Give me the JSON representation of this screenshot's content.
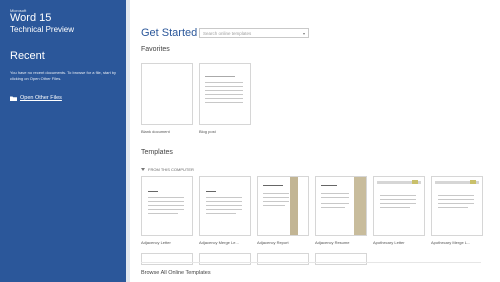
{
  "sidebar": {
    "brand_small": "Microsoft",
    "title": "Word 15",
    "subtitle": "Technical Preview",
    "recent_heading": "Recent",
    "recent_message": "You have no recent documents. To browse for a file, start by clicking on Open Other Files.",
    "open_other_label": "Open Other Files"
  },
  "main": {
    "heading": "Get Started",
    "search_placeholder": "Search online templates",
    "favorites_heading": "Favorites",
    "favorites": [
      {
        "label": "Blank document"
      },
      {
        "label": "Blog post"
      }
    ],
    "templates_heading": "Templates",
    "templates_group": "FROM THIS COMPUTER",
    "templates": [
      {
        "label": "Adjacency Letter"
      },
      {
        "label": "Adjacency Merge Le..."
      },
      {
        "label": "Adjacency Report"
      },
      {
        "label": "Adjacency Resume"
      },
      {
        "label": "Apothecary Letter"
      },
      {
        "label": "Apothecary Merge L..."
      }
    ],
    "browse_label": "Browse All Online Templates"
  },
  "colors": {
    "sidebar_bg": "#2b579a",
    "accent": "#2b579a"
  },
  "icons": {
    "folder": "folder-icon",
    "dropdown": "chevron-down-icon"
  }
}
